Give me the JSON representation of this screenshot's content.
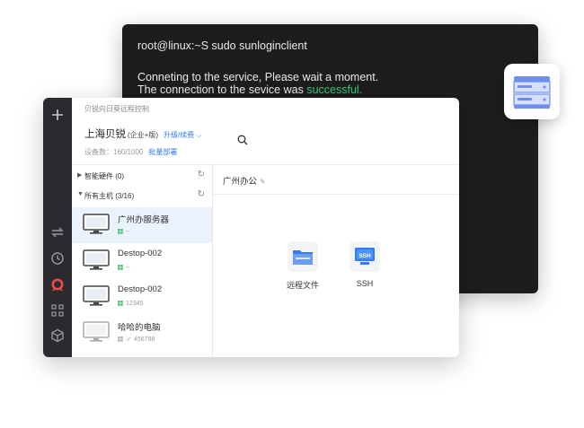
{
  "terminal": {
    "command": "root@linux:~S sudo sunloginclient",
    "line1": "Conneting to the service, Please wait a moment.",
    "line2_prefix": "The connection to the sevice was ",
    "line2_status": "successful.",
    "status_color": "#2ecc71"
  },
  "server_badge": {
    "icon": "server-icon"
  },
  "client": {
    "app_title": "贝锐向日葵远程控制",
    "rail_icons": [
      "add-icon",
      "transfer-icon",
      "history-icon",
      "sunlogin-logo-icon",
      "grid-icon",
      "cube-icon"
    ],
    "company": "上海贝锐",
    "edition": "(企业+版)",
    "upgrade_label": "升级/续费",
    "device_count": "设备数：160/1000",
    "batch_deploy": "批量部署",
    "search": {
      "placeholder": "",
      "icon": "search-icon"
    },
    "groups": [
      {
        "label": "智能硬件 (0)",
        "expanded": false
      },
      {
        "label": "所有主机 (3/16)",
        "expanded": true
      }
    ],
    "hosts": [
      {
        "name": "广州办服务器",
        "sub": "--",
        "active": true
      },
      {
        "name": "Destop-002",
        "sub": "--",
        "active": false
      },
      {
        "name": "Destop-002",
        "sub": "12345",
        "active": false
      },
      {
        "name": "哈哈的电脑",
        "sub": "456788",
        "active": false
      }
    ],
    "content_title": "广州办公",
    "tiles": [
      {
        "label": "远程文件",
        "icon": "folder-icon"
      },
      {
        "label": "SSH",
        "icon": "ssh-icon"
      }
    ],
    "accent_color": "#2f7bf5"
  }
}
